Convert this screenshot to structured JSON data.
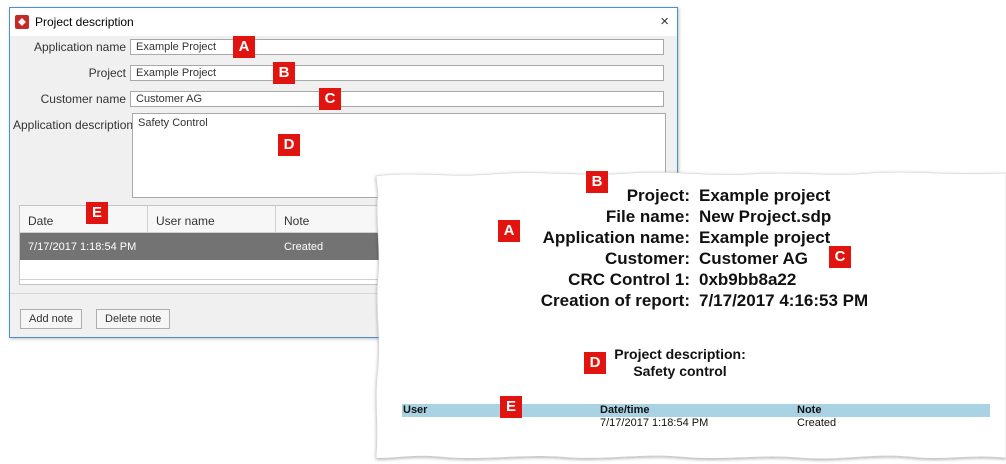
{
  "dialog": {
    "title": "Project description",
    "close_glyph": "×",
    "fields": {
      "application_name": {
        "label": "Application name",
        "value": "Example Project"
      },
      "project": {
        "label": "Project",
        "value": "Example Project"
      },
      "customer_name": {
        "label": "Customer name",
        "value": "Customer AG"
      },
      "application_description": {
        "label": "Application description",
        "value": "Safety Control"
      }
    },
    "notes_table": {
      "columns": [
        "Date",
        "User name",
        "Note"
      ],
      "rows": [
        {
          "date": "7/17/2017 1:18:54 PM",
          "user": "",
          "note": "Created"
        }
      ]
    },
    "buttons": {
      "add_note": "Add note",
      "delete_note": "Delete note"
    }
  },
  "markers": {
    "a": "A",
    "b": "B",
    "c": "C",
    "d": "D",
    "e": "E"
  },
  "report": {
    "lines": [
      {
        "label": "Project:",
        "value": "Example project"
      },
      {
        "label": "File name:",
        "value": "New Project.sdp"
      },
      {
        "label": "Application name:",
        "value": "Example project"
      },
      {
        "label": "Customer:",
        "value": "Customer AG"
      },
      {
        "label": "CRC Control 1:",
        "value": "0xb9bb8a22"
      },
      {
        "label": "Creation of report:",
        "value": "7/17/2017 4:16:53 PM"
      }
    ],
    "description_heading": "Project description:",
    "description_value": "Safety control",
    "table": {
      "columns": [
        "User",
        "Date/time",
        "Note"
      ],
      "rows": [
        {
          "user": "",
          "datetime": "7/17/2017 1:18:54 PM",
          "note": "Created"
        }
      ]
    }
  },
  "colors": {
    "marker_red": "#e1140f",
    "report_table_header": "#a9d3e3",
    "selected_row": "#737373",
    "window_border": "#4a90d9"
  }
}
